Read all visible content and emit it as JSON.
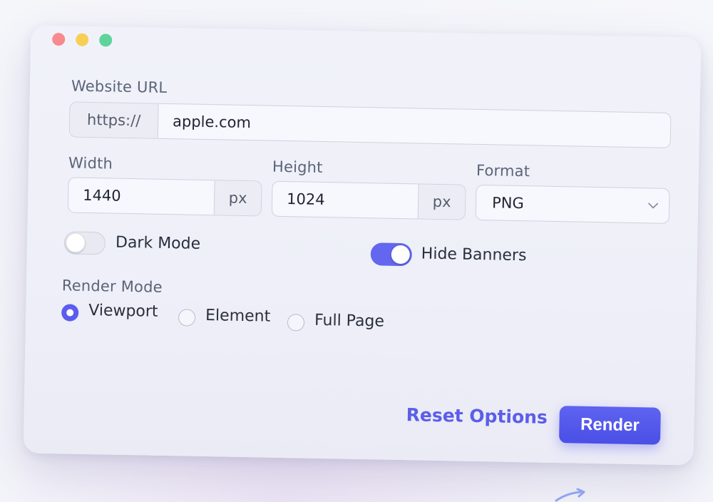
{
  "window": {
    "controls": {
      "close_color": "#f88a8f",
      "minimize_color": "#f8cf55",
      "maximize_color": "#5fd49a"
    }
  },
  "form": {
    "url": {
      "label": "Website URL",
      "prefix": "https://",
      "value": "apple.com"
    },
    "width": {
      "label": "Width",
      "value": "1440",
      "unit": "px"
    },
    "height": {
      "label": "Height",
      "value": "1024",
      "unit": "px"
    },
    "format": {
      "label": "Format",
      "selected": "PNG",
      "icon": "chevron-down-icon"
    },
    "toggles": {
      "dark_mode": {
        "label": "Dark Mode",
        "on": false
      },
      "hide_banners": {
        "label": "Hide Banners",
        "on": true
      }
    },
    "render_mode": {
      "label": "Render Mode",
      "options": [
        {
          "label": "Viewport",
          "selected": true
        },
        {
          "label": "Element",
          "selected": false
        },
        {
          "label": "Full Page",
          "selected": false
        }
      ]
    }
  },
  "actions": {
    "reset_label": "Reset Options",
    "render_label": "Render"
  },
  "colors": {
    "accent": "#5b5cf0",
    "toggle_on": "#6366ee"
  }
}
